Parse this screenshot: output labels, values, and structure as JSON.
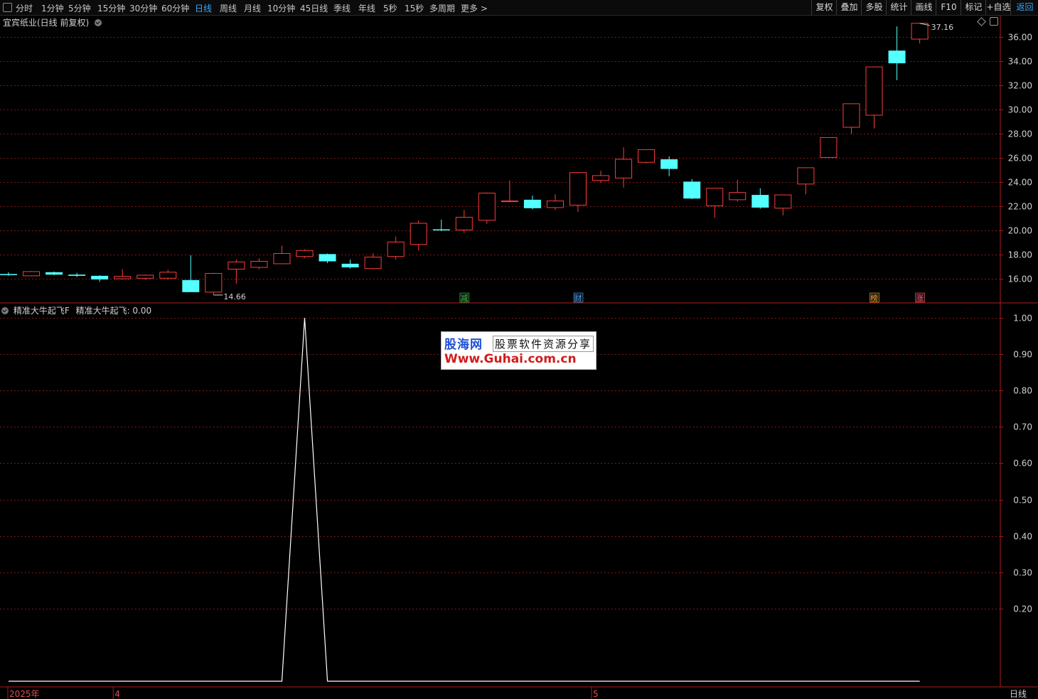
{
  "toolbar": {
    "periods": [
      "分时",
      "1分钟",
      "5分钟",
      "15分钟",
      "30分钟",
      "60分钟",
      "日线",
      "周线",
      "月线",
      "10分钟",
      "45日线",
      "季线",
      "年线",
      "5秒",
      "15秒",
      "多周期",
      "更多 >"
    ],
    "active": "日线",
    "right": [
      "复权",
      "叠加",
      "多股",
      "统计",
      "画线",
      "F10",
      "标记",
      "+自选",
      "返回"
    ]
  },
  "main": {
    "title": "宜宾纸业(日线 前复权)",
    "high_label": "37.16",
    "low_label": "14.66",
    "price_ticks": [
      "36.00",
      "34.00",
      "32.00",
      "30.00",
      "28.00",
      "26.00",
      "24.00",
      "22.00",
      "20.00",
      "18.00",
      "16.00"
    ],
    "event_markers": [
      {
        "text": "减",
        "color": "#1fbf3a",
        "bar": 20
      },
      {
        "text": "财",
        "color": "#3ba0ff",
        "bar": 25
      },
      {
        "text": "榜",
        "color": "#f0a020",
        "bar": 38
      },
      {
        "text": "涨",
        "color": "#ff4d6a",
        "bar": 40
      }
    ]
  },
  "indicator": {
    "name": "精准大牛起飞F",
    "value_label": "精准大牛起飞: 0.00",
    "ticks": [
      "1.00",
      "0.90",
      "0.80",
      "0.70",
      "0.60",
      "0.50",
      "0.40",
      "0.30",
      "0.20"
    ]
  },
  "axis": {
    "labels": [
      {
        "text": "2025年",
        "bar": 0
      },
      {
        "text": "4",
        "bar": 5
      },
      {
        "text": "5",
        "bar": 26
      }
    ],
    "period_label": "日线"
  },
  "watermark": {
    "logo": "股海网",
    "slogan": "股票软件资源分享",
    "url": "Www.Guhai.com.cn"
  },
  "colors": {
    "up": "#ff3b3b",
    "down": "#54ffff",
    "grid": "#7a1a1a",
    "frame": "#b01c1c",
    "text": "#d0d0d0"
  },
  "chart_data": [
    {
      "type": "candlestick",
      "title": "宜宾纸业(日线 前复权)",
      "ylim": [
        14.3,
        37.5
      ],
      "candles": [
        {
          "o": 16.4,
          "h": 16.55,
          "l": 16.25,
          "c": 16.35
        },
        {
          "o": 16.25,
          "h": 16.65,
          "l": 16.2,
          "c": 16.6
        },
        {
          "o": 16.55,
          "h": 16.6,
          "l": 16.3,
          "c": 16.35
        },
        {
          "o": 16.35,
          "h": 16.5,
          "l": 16.15,
          "c": 16.25
        },
        {
          "o": 16.25,
          "h": 16.3,
          "l": 15.75,
          "c": 15.95
        },
        {
          "o": 16.0,
          "h": 16.8,
          "l": 15.95,
          "c": 16.2
        },
        {
          "o": 16.05,
          "h": 16.35,
          "l": 15.9,
          "c": 16.3
        },
        {
          "o": 16.05,
          "h": 16.75,
          "l": 15.95,
          "c": 16.55
        },
        {
          "o": 15.9,
          "h": 17.95,
          "l": 14.95,
          "c": 14.9
        },
        {
          "o": 14.9,
          "h": 16.5,
          "l": 14.66,
          "c": 16.45
        },
        {
          "o": 16.8,
          "h": 17.6,
          "l": 15.6,
          "c": 17.4
        },
        {
          "o": 16.95,
          "h": 17.7,
          "l": 16.8,
          "c": 17.45
        },
        {
          "o": 17.25,
          "h": 18.75,
          "l": 17.2,
          "c": 18.1
        },
        {
          "o": 17.85,
          "h": 18.45,
          "l": 17.7,
          "c": 18.35
        },
        {
          "o": 18.05,
          "h": 18.1,
          "l": 17.3,
          "c": 17.45
        },
        {
          "o": 17.25,
          "h": 17.6,
          "l": 16.85,
          "c": 16.95
        },
        {
          "o": 16.85,
          "h": 18.1,
          "l": 16.8,
          "c": 17.8
        },
        {
          "o": 17.85,
          "h": 19.5,
          "l": 17.6,
          "c": 19.05
        },
        {
          "o": 18.85,
          "h": 20.85,
          "l": 18.35,
          "c": 20.6
        },
        {
          "o": 20.1,
          "h": 20.9,
          "l": 19.95,
          "c": 20.05
        },
        {
          "o": 20.05,
          "h": 21.7,
          "l": 19.8,
          "c": 21.1
        },
        {
          "o": 20.85,
          "h": 23.15,
          "l": 20.55,
          "c": 23.1
        },
        {
          "o": 22.45,
          "h": 24.15,
          "l": 22.35,
          "c": 22.45
        },
        {
          "o": 22.55,
          "h": 22.9,
          "l": 21.75,
          "c": 21.85
        },
        {
          "o": 21.9,
          "h": 23.0,
          "l": 21.7,
          "c": 22.45
        },
        {
          "o": 22.1,
          "h": 24.8,
          "l": 21.55,
          "c": 24.8
        },
        {
          "o": 24.15,
          "h": 24.95,
          "l": 23.95,
          "c": 24.55
        },
        {
          "o": 24.35,
          "h": 26.9,
          "l": 23.55,
          "c": 25.9
        },
        {
          "o": 25.65,
          "h": 26.7,
          "l": 25.55,
          "c": 26.7
        },
        {
          "o": 25.9,
          "h": 26.15,
          "l": 24.5,
          "c": 25.1
        },
        {
          "o": 24.05,
          "h": 24.25,
          "l": 22.6,
          "c": 22.65
        },
        {
          "o": 22.05,
          "h": 23.5,
          "l": 21.05,
          "c": 23.5
        },
        {
          "o": 22.55,
          "h": 24.2,
          "l": 22.4,
          "c": 23.15
        },
        {
          "o": 22.95,
          "h": 23.5,
          "l": 21.8,
          "c": 21.9
        },
        {
          "o": 21.85,
          "h": 22.95,
          "l": 21.25,
          "c": 22.95
        },
        {
          "o": 23.85,
          "h": 25.2,
          "l": 23.0,
          "c": 25.2
        },
        {
          "o": 26.05,
          "h": 27.7,
          "l": 26.0,
          "c": 27.7
        },
        {
          "o": 28.55,
          "h": 30.5,
          "l": 28.0,
          "c": 30.5
        },
        {
          "o": 29.55,
          "h": 33.55,
          "l": 28.45,
          "c": 33.55
        },
        {
          "o": 34.9,
          "h": 36.9,
          "l": 32.45,
          "c": 33.85
        },
        {
          "o": 35.85,
          "h": 37.16,
          "l": 35.5,
          "c": 37.16
        }
      ]
    },
    {
      "type": "line",
      "name": "精准大牛起飞",
      "ylim": [
        0,
        1.0
      ],
      "values": [
        0,
        0,
        0,
        0,
        0,
        0,
        0,
        0,
        0,
        0,
        0,
        0,
        0,
        1,
        0,
        0,
        0,
        0,
        0,
        0,
        0,
        0,
        0,
        0,
        0,
        0,
        0,
        0,
        0,
        0,
        0,
        0,
        0,
        0,
        0,
        0,
        0,
        0,
        0,
        0,
        0
      ]
    }
  ]
}
